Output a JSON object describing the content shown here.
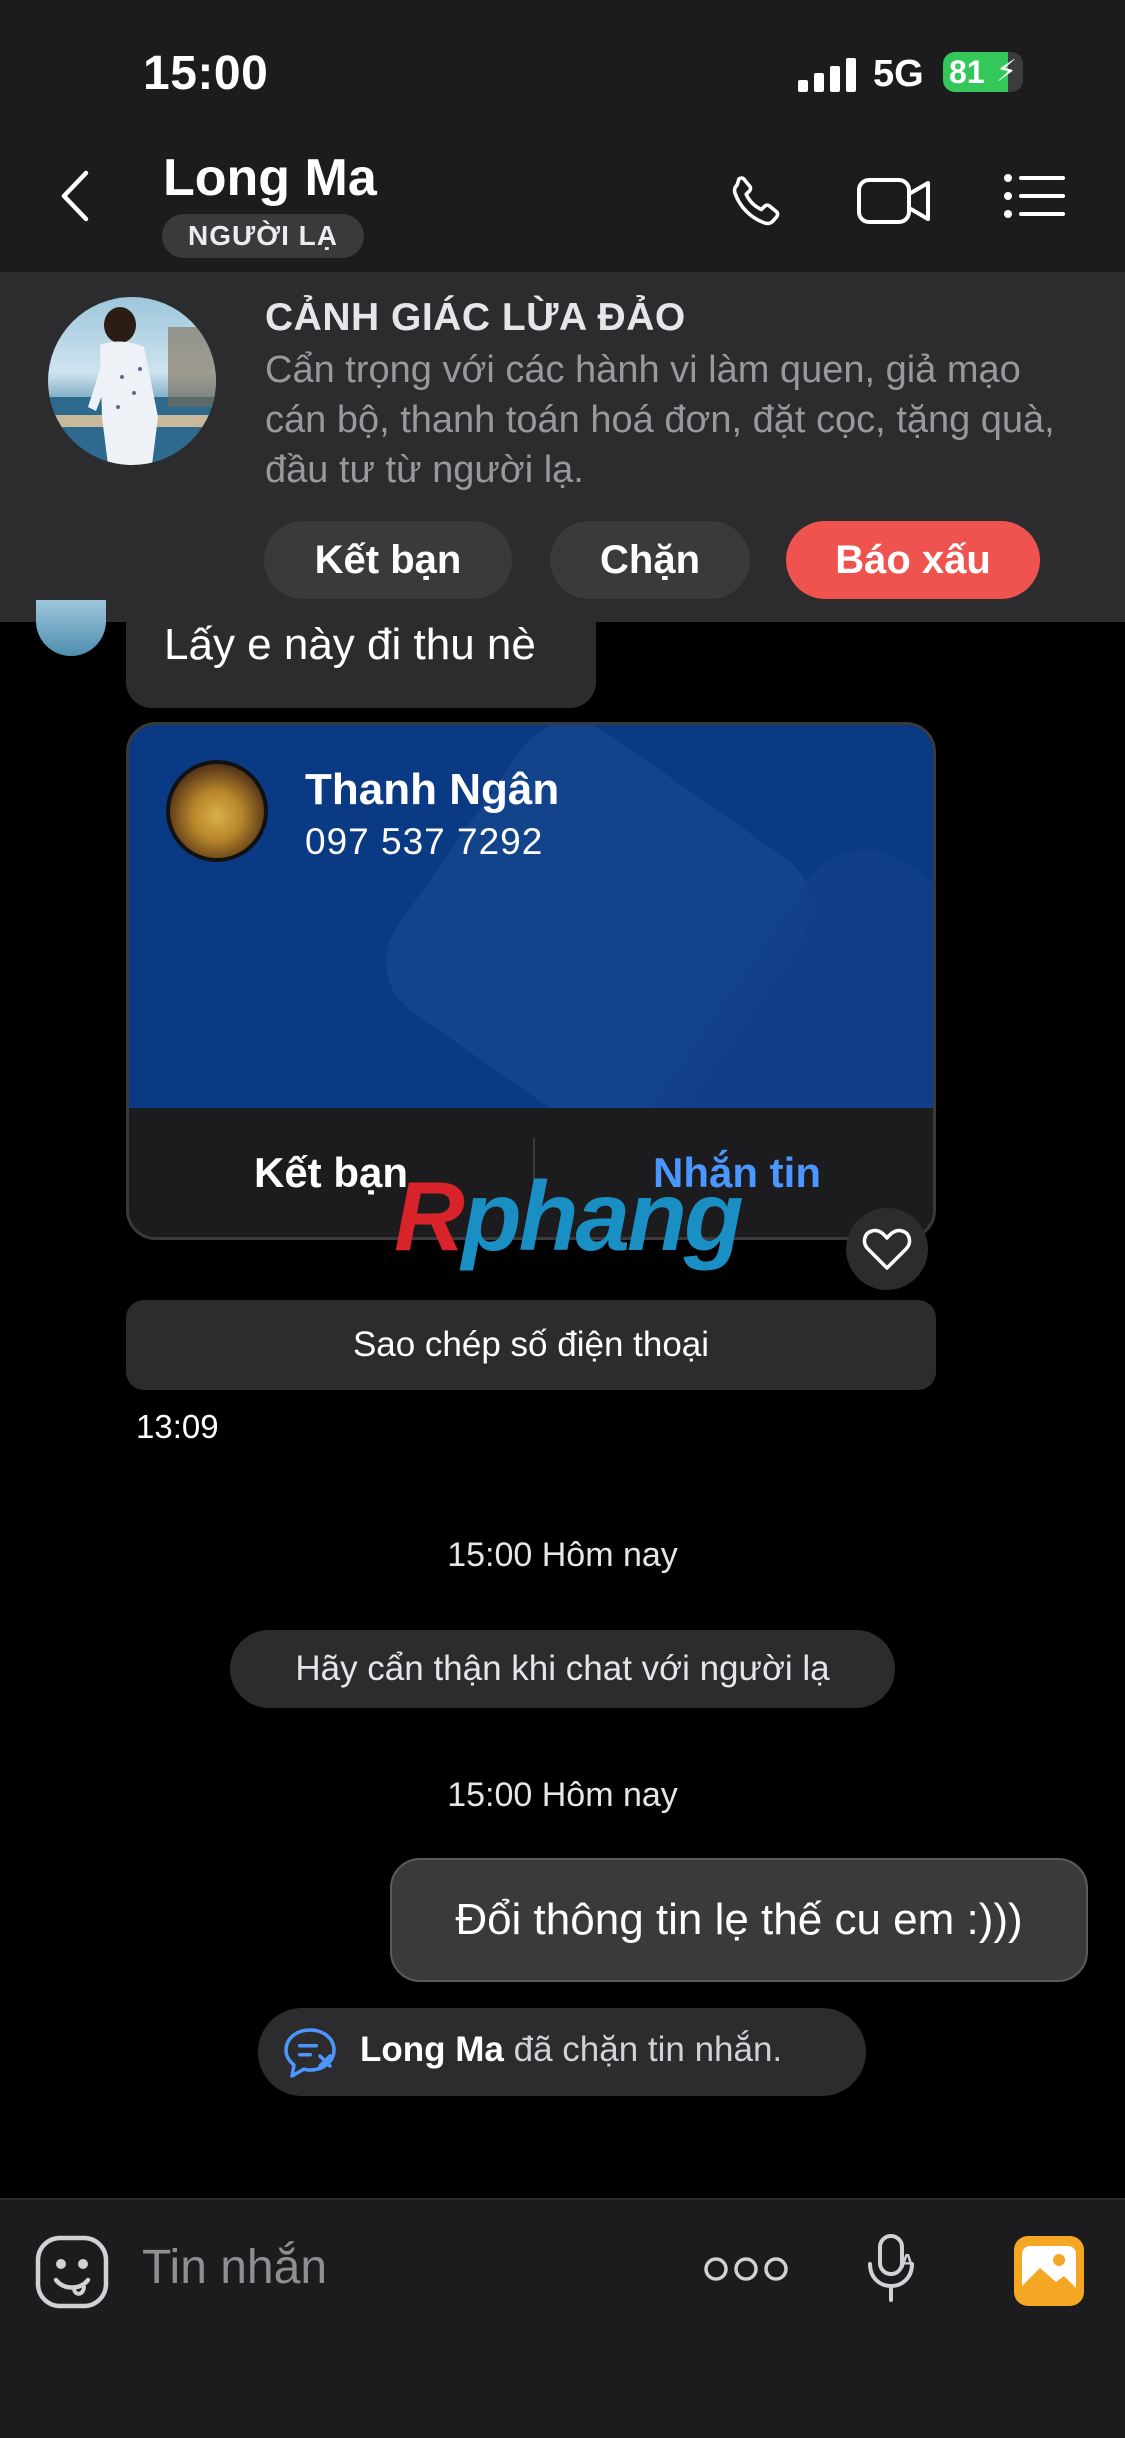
{
  "status_bar": {
    "time": "15:00",
    "network": "5G",
    "battery": "81",
    "battery_level": 0.81
  },
  "header": {
    "name": "Long Ma",
    "tag": "NGƯỜI LẠ"
  },
  "warning": {
    "title": "CẢNH GIÁC LỪA ĐẢO",
    "text": "Cẩn trọng với các hành vi làm quen, giả mạo cán bộ, thanh toán hoá đơn, đặt cọc, tặng quà, đầu tư từ người lạ.",
    "add_friend": "Kết bạn",
    "block": "Chặn",
    "report": "Báo xấu",
    "report_color": "#ef5350"
  },
  "messages": {
    "incoming_text": "Lấy e này đi thu nè",
    "contact_card": {
      "name": "Thanh Ngân",
      "phone": "097 537 7292",
      "add_friend": "Kết bạn",
      "message": "Nhắn tin"
    },
    "copy_phone": "Sao chép số điện thoại",
    "incoming_time": "13:09",
    "stamp1": "15:00 Hôm nay",
    "system_notice": "Hãy cẩn thận khi chat với người lạ",
    "stamp2": "15:00 Hôm nay",
    "outgoing_text": "Đổi thông tin lẹ thế cu em :)))",
    "blocked_name": "Long Ma",
    "blocked_text": "đã chặn tin nhắn."
  },
  "watermark": {
    "part1": "R",
    "part2": "phang"
  },
  "input": {
    "placeholder": "Tin nhắn"
  },
  "colors": {
    "accent": "#4c97ff",
    "card_bg": "#0a3a83",
    "battery": "#34c759"
  }
}
